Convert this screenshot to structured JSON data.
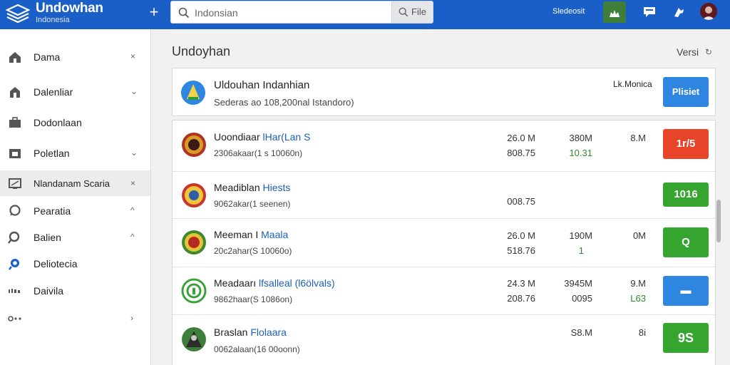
{
  "header": {
    "brand_title": "Undowhan",
    "brand_subtitle": "Indonesia",
    "search_placeholder": "Indonsian",
    "file_button": "File",
    "top_link": "Sledeosit",
    "icons": [
      "plus-icon",
      "search-icon",
      "home-icon",
      "chat-icon",
      "puzzle-icon"
    ]
  },
  "sidebar": {
    "items": [
      {
        "label": "Dama",
        "chevron": "×"
      },
      {
        "label": "Dalenliar",
        "chevron": "⌄"
      },
      {
        "label": "Dodonlaan",
        "chevron": ""
      },
      {
        "label": "Poletlan",
        "chevron": "⌄"
      },
      {
        "label": "Nlandanam Scaria",
        "chevron": "×"
      },
      {
        "label": "Pearatia",
        "chevron": "^"
      },
      {
        "label": "Balien",
        "chevron": "^"
      },
      {
        "label": "Deliotecia",
        "chevron": ""
      },
      {
        "label": "Daivila",
        "chevron": ""
      },
      {
        "label": "",
        "chevron": "›"
      }
    ]
  },
  "main": {
    "title": "Undoyhan",
    "version_label": "Versi",
    "header_card": {
      "title": "Uldouhan Indanhian",
      "subtitle": "Sederas ao 108,200nal Istandoro)",
      "side_label": "Lk.Monica",
      "button_label": "Plisiet",
      "button_color": "#2f86e0"
    },
    "rows": [
      {
        "title": "Uoondiaar",
        "title_hl": "lHar(Lan S",
        "subtitle": "2306akaar(1 s 10060n)",
        "stats": [
          "26.0 M",
          "808.75",
          "380M",
          "10.31",
          "8.M",
          ""
        ],
        "button": "1r/5",
        "button_color": "#e8442a"
      },
      {
        "title": "Meadiblan",
        "title_hl": "Hiests",
        "subtitle": "9062akar(1 seenen)",
        "stats": [
          "",
          "008.75",
          "",
          "",
          "",
          ""
        ],
        "button": "1016",
        "button_color": "#35a52f"
      },
      {
        "title": "Meeman I",
        "title_hl": "Maala",
        "subtitle": "20c2ahar(S 10060o)",
        "stats": [
          "26.0 M",
          "518.76",
          "190M",
          "1",
          "0M",
          ""
        ],
        "button": "Q",
        "button_color": "#35a52f"
      },
      {
        "title": "Meadaarı",
        "title_hl": "lfsalleal (l6ölvals)",
        "subtitle": "9862haar(S 1086on)",
        "stats": [
          "24.3 M",
          "208.76",
          "3945M",
          "0095",
          "9.M",
          "L63"
        ],
        "button": "▬",
        "button_color": "#2f86e0"
      },
      {
        "title": "Braslan",
        "title_hl": "Flolaara",
        "subtitle": "0062alaan(16 00oonn)",
        "stats": [
          "",
          "",
          "S8.M",
          "",
          "8i",
          ""
        ],
        "button": "9S",
        "button_color": "#35a52f"
      }
    ]
  }
}
